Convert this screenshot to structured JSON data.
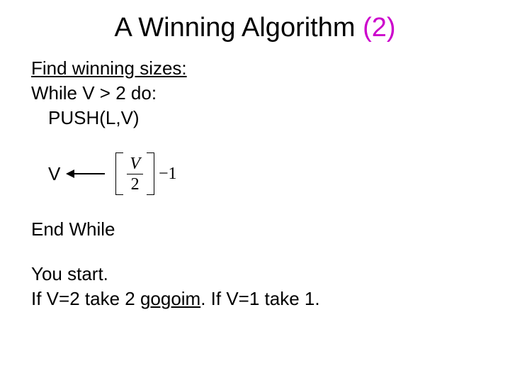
{
  "title": {
    "part1": "A Winning Algorithm ",
    "part2": " (2)"
  },
  "content": {
    "heading": "Find winning sizes:",
    "while_line": "While V > 2 do:",
    "push_line": "PUSH(L,V)",
    "assign_var": "V",
    "formula": {
      "numer": "V",
      "denom": "2",
      "tail": "−1"
    },
    "end_while": "End While",
    "you_start": "You start.",
    "if_line_a": "If V=2 take 2 ",
    "if_line_gogoim": "gogoim",
    "if_line_b": ". If V=1 take 1."
  }
}
